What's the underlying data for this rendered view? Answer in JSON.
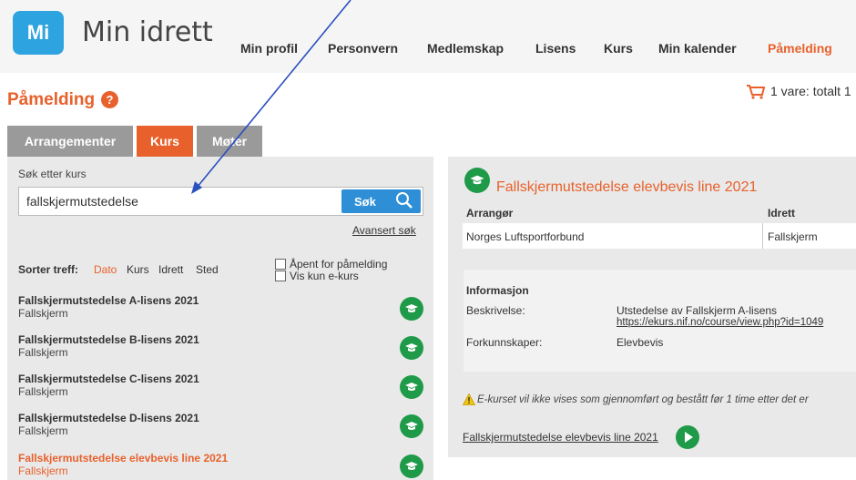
{
  "brand": {
    "logo": "Mi",
    "name": "Min idrett",
    "accent": "#e8612c",
    "blue": "#2e8fd6",
    "green": "#1e9a48"
  },
  "nav": [
    "Min profil",
    "Personvern",
    "Medlemskap",
    "Lisens",
    "Kurs",
    "Min kalender",
    "Påmelding"
  ],
  "page": {
    "title": "Påmelding",
    "help": "?",
    "cart": "1 vare: totalt 1"
  },
  "tabs": [
    "Arrangementer",
    "Kurs",
    "Møter"
  ],
  "search": {
    "label": "Søk etter kurs",
    "value": "fallskjermutstedelse",
    "button": "Søk",
    "advanced": "Avansert søk"
  },
  "sort": {
    "label": "Sorter treff:",
    "options": [
      "Dato",
      "Kurs",
      "Idrett",
      "Sted"
    ]
  },
  "filters": [
    "Åpent for påmelding",
    "Vis kun e-kurs"
  ],
  "courses": [
    {
      "name": "Fallskjermutstedelse A-lisens 2021",
      "sport": "Fallskjerm"
    },
    {
      "name": "Fallskjermutstedelse B-lisens 2021",
      "sport": "Fallskjerm"
    },
    {
      "name": "Fallskjermutstedelse C-lisens 2021",
      "sport": "Fallskjerm"
    },
    {
      "name": "Fallskjermutstedelse D-lisens 2021",
      "sport": "Fallskjerm"
    },
    {
      "name": "Fallskjermutstedelse elevbevis line 2021",
      "sport": "Fallskjerm"
    }
  ],
  "detail": {
    "title": "Fallskjermutstedelse elevbevis line 2021",
    "col_organizer": "Arrangør",
    "col_sport": "Idrett",
    "organizer": "Norges Luftsportforbund",
    "sport": "Fallskjerm",
    "info_title": "Informasjon",
    "desc_label": "Beskrivelse:",
    "desc_value": "Utstedelse av Fallskjerm A-lisens",
    "desc_link": "https://ekurs.nif.no/course/view.php?id=1049",
    "prereq_label": "Forkunnskaper:",
    "prereq_value": "Elevbevis",
    "warning": "E-kurset vil ikke vises som gjennomført og bestått før 1 time etter det er",
    "bottom_link": "Fallskjermutstedelse elevbevis line 2021"
  }
}
